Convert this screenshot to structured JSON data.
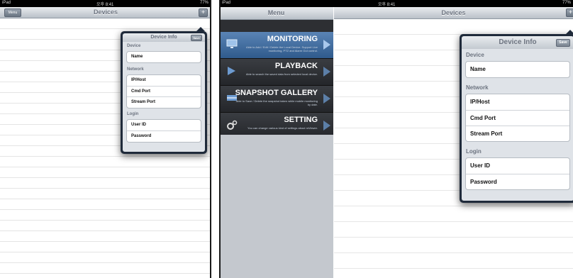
{
  "screen1": {
    "status": {
      "carrier": "iPad ",
      "time": "오후 8:41",
      "battery": "77%"
    },
    "nav": {
      "menu_label": "Menu",
      "title": "Devices",
      "add_label": "+"
    },
    "popover": {
      "title": "Device Info",
      "save_label": "Save",
      "sections": {
        "device": "Device",
        "network": "Network",
        "login": "Login"
      },
      "fields": {
        "name": "Name",
        "iphost": "IP/Host",
        "cmdport": "Cmd Port",
        "streamport": "Stream Port",
        "userid": "User ID",
        "password": "Password"
      }
    }
  },
  "screen2": {
    "status": {
      "carrier": "iPad ",
      "time": "오후 8:41",
      "battery": "77%"
    },
    "menu": {
      "title": "Menu",
      "items": [
        {
          "title": "MONITORING",
          "desc": "Able to Add / Edit / Delete the Local Device. Support Live monitoring, PTZ and Alarm Out control."
        },
        {
          "title": "PLAYBACK",
          "desc": "Able to search the saved data from selected local device."
        },
        {
          "title": "SNAPSHOT GALLERY",
          "desc": "Able to Save / Delete the snapshot taken while mobile monitoring by date."
        },
        {
          "title": "SETTING",
          "desc": "You can change various kind of settings about mViewer."
        }
      ]
    },
    "nav": {
      "title": "Devices",
      "add_label": "+"
    },
    "popover": {
      "title": "Device Info",
      "save_label": "Save",
      "sections": {
        "device": "Device",
        "network": "Network",
        "login": "Login"
      },
      "fields": {
        "name": "Name",
        "iphost": "IP/Host",
        "cmdport": "Cmd Port",
        "streamport": "Stream Port",
        "userid": "User ID",
        "password": "Password"
      }
    }
  },
  "colors": {
    "nav_title": "#6d7480",
    "menu_active": "#3f6da0",
    "popover_frame": "#1f2a3a"
  }
}
